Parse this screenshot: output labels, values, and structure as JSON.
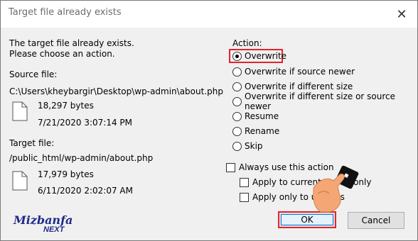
{
  "window": {
    "title": "Target file already exists",
    "close_glyph": "✕"
  },
  "message": {
    "line1": "The target file already exists.",
    "line2": "Please choose an action."
  },
  "source": {
    "label": "Source file:",
    "path": "C:\\Users\\kheybargir\\Desktop\\wp-admin\\about.php",
    "size": "18,297 bytes",
    "date": "7/21/2020 3:07:14 PM"
  },
  "target": {
    "label": "Target file:",
    "path": "/public_html/wp-admin/about.php",
    "size": "17,979 bytes",
    "date": "6/11/2020 2:02:07 AM"
  },
  "action": {
    "label": "Action:",
    "options": [
      {
        "label": "Overwrite",
        "checked": true
      },
      {
        "label": "Overwrite if source newer",
        "checked": false
      },
      {
        "label": "Overwrite if different size",
        "checked": false
      },
      {
        "label": "Overwrite if different size or source newer",
        "checked": false
      },
      {
        "label": "Resume",
        "checked": false
      },
      {
        "label": "Rename",
        "checked": false
      },
      {
        "label": "Skip",
        "checked": false
      }
    ]
  },
  "options": {
    "always": "Always use this action",
    "current_queue": "Apply to current queue only",
    "uploads": "Apply only to uploads"
  },
  "buttons": {
    "ok": "OK",
    "cancel": "Cancel"
  },
  "branding": {
    "logo_text": "Mizbanfa",
    "logo_sub": "NEXT"
  },
  "colors": {
    "highlight": "#e3232f",
    "focus": "#0078d7",
    "logo": "#1f2a8a"
  }
}
